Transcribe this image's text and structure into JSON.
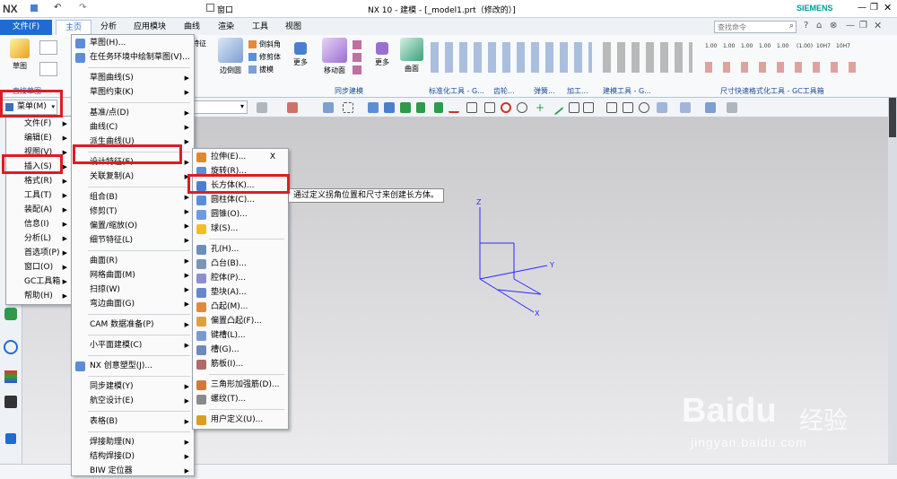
{
  "title_bar": {
    "logo": "NX",
    "window_menu": "窗口",
    "title": "NX 10 - 建模 - [_model1.prt（修改的）]",
    "brand": "SIEMENS"
  },
  "ribbon": {
    "tabs": [
      "文件(F)",
      "主页",
      "分析",
      "应用模块",
      "曲线",
      "渲染",
      "工具",
      "视图"
    ],
    "active_tab": "主页",
    "search_placeholder": "查找命令",
    "buttons": {
      "sketch": "草图",
      "edge_blend": "边倒圆",
      "chamfer": "倒斜角",
      "trim_body": "修剪体",
      "draft": "拔模",
      "more1": "更多",
      "move_face": "移动面",
      "more2": "更多",
      "surface": "曲面"
    },
    "groups": [
      "直接草图",
      "同步建模",
      "标准化工具 - G...",
      "齿轮...",
      "弹簧...",
      "加工...",
      "建模工具 - G...",
      "尺寸快速格式化工具 - GC工具箱"
    ],
    "partial_labels": [
      "特征"
    ],
    "dim_labels": [
      "1.00",
      "1.00",
      "1.00",
      "1.00",
      "1.00",
      "(1.00)",
      "10H7",
      "10H7"
    ]
  },
  "menu_button": {
    "label": "菜单(M)"
  },
  "main_menu": [
    {
      "label": "文件(F)",
      "arrow": true
    },
    {
      "label": "编辑(E)",
      "arrow": true
    },
    {
      "label": "视图(V)",
      "arrow": true
    },
    {
      "label": "插入(S)",
      "arrow": true,
      "highlight": true
    },
    {
      "label": "格式(R)",
      "arrow": true
    },
    {
      "label": "工具(T)",
      "arrow": true
    },
    {
      "label": "装配(A)",
      "arrow": true
    },
    {
      "label": "信息(I)",
      "arrow": true
    },
    {
      "label": "分析(L)",
      "arrow": true
    },
    {
      "label": "首选项(P)",
      "arrow": true
    },
    {
      "label": "窗口(O)",
      "arrow": true
    },
    {
      "label": "GC工具箱",
      "arrow": true
    },
    {
      "label": "帮助(H)",
      "arrow": true
    }
  ],
  "insert_menu": [
    {
      "label": "草图(H)...",
      "arrow": false,
      "icon": "sketch-icon"
    },
    {
      "label": "在任务环境中绘制草图(V)...",
      "arrow": false,
      "icon": "sketch-task-icon"
    },
    {
      "label": "草图曲线(S)",
      "arrow": true
    },
    {
      "label": "草图约束(K)",
      "arrow": true
    },
    {
      "label": "基准/点(D)",
      "arrow": true
    },
    {
      "label": "曲线(C)",
      "arrow": true
    },
    {
      "label": "派生曲线(U)",
      "arrow": true
    },
    {
      "label": "设计特征(E)",
      "arrow": true,
      "highlight": true
    },
    {
      "label": "关联复制(A)",
      "arrow": true
    },
    {
      "label": "组合(B)",
      "arrow": true
    },
    {
      "label": "修剪(T)",
      "arrow": true
    },
    {
      "label": "偏置/缩放(O)",
      "arrow": true
    },
    {
      "label": "细节特征(L)",
      "arrow": true
    },
    {
      "label": "曲面(R)",
      "arrow": true
    },
    {
      "label": "网格曲面(M)",
      "arrow": true
    },
    {
      "label": "扫掠(W)",
      "arrow": true
    },
    {
      "label": "弯边曲面(G)",
      "arrow": true
    },
    {
      "label": "CAM 数据准备(P)",
      "arrow": true
    },
    {
      "label": "小平面建模(C)",
      "arrow": true
    },
    {
      "label": "NX 创意塑型(J)...",
      "arrow": false,
      "icon": "nx-realize-icon"
    },
    {
      "label": "同步建模(Y)",
      "arrow": true
    },
    {
      "label": "航空设计(E)",
      "arrow": true
    },
    {
      "label": "表格(B)",
      "arrow": true
    },
    {
      "label": "焊接助理(N)",
      "arrow": true
    },
    {
      "label": "结构焊接(D)",
      "arrow": true
    },
    {
      "label": "BIW 定位器",
      "arrow": true
    }
  ],
  "design_feature_menu": {
    "close": "X",
    "items": [
      {
        "label": "拉伸(E)...",
        "icon": "extrude-icon",
        "color": "#e0892b"
      },
      {
        "label": "旋转(R)...",
        "icon": "revolve-icon",
        "color": "#5b8ed6"
      },
      {
        "label": "长方体(K)...",
        "icon": "block-icon",
        "color": "#4a7fd0",
        "highlight": true
      },
      {
        "label": "圆柱体(C)...",
        "icon": "cylinder-icon",
        "color": "#5b8ed6"
      },
      {
        "label": "圆锥(O)...",
        "icon": "cone-icon",
        "color": "#6c9be0"
      },
      {
        "label": "球(S)...",
        "icon": "sphere-icon",
        "color": "#f0c020"
      },
      {
        "label": "孔(H)...",
        "icon": "hole-icon",
        "color": "#6c8fb8"
      },
      {
        "label": "凸台(B)...",
        "icon": "boss-icon",
        "color": "#7c95b5"
      },
      {
        "label": "腔体(P)...",
        "icon": "pocket-icon",
        "color": "#8a8fd0"
      },
      {
        "label": "垫块(A)...",
        "icon": "pad-icon",
        "color": "#6688c8"
      },
      {
        "label": "凸起(M)...",
        "icon": "emboss-icon",
        "color": "#e08a3a"
      },
      {
        "label": "偏置凸起(F)...",
        "icon": "offset-emboss-icon",
        "color": "#e0a040"
      },
      {
        "label": "键槽(L)...",
        "icon": "slot-icon",
        "color": "#7a9ad0"
      },
      {
        "label": "槽(G)...",
        "icon": "groove-icon",
        "color": "#6f89b9"
      },
      {
        "label": "筋板(I)...",
        "icon": "rib-icon",
        "color": "#b06a6a"
      },
      {
        "label": "三角形加强筋(D)...",
        "icon": "dart-icon",
        "color": "#d07a3a"
      },
      {
        "label": "螺纹(T)...",
        "icon": "thread-icon",
        "color": "#8a8a8a"
      },
      {
        "label": "用户定义(U)...",
        "icon": "user-defined-icon",
        "color": "#d8a020"
      }
    ]
  },
  "tooltip": "通过定义拐角位置和尺寸来创建长方体。",
  "axes": {
    "z": "Z",
    "y": "Y",
    "x": "X"
  },
  "watermark": {
    "brand": "Baidu",
    "subtitle": "经验",
    "url": "jingyan.baidu.com"
  },
  "colors": {
    "accent": "#1f6bd1",
    "highlight_box": "#e01b24",
    "triad": "#2a2aff"
  }
}
